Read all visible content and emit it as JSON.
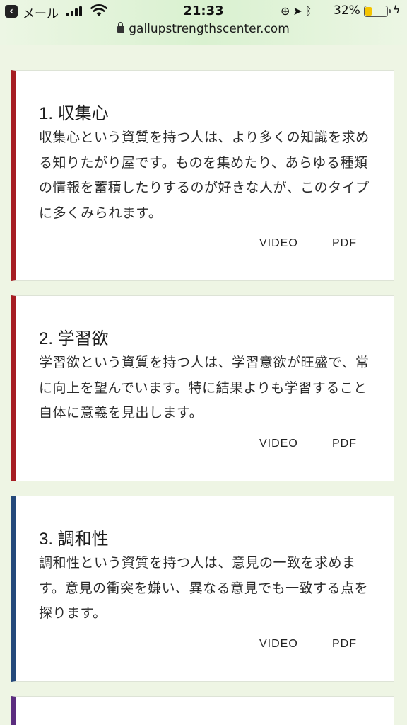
{
  "status": {
    "carrier": "メール",
    "time": "21:33",
    "battery_pct": "32%",
    "battery_level": 0.32,
    "battery_color": "#f5c400"
  },
  "browser": {
    "url": "gallupstrengthscenter.com"
  },
  "cards": [
    {
      "title": "1. 収集心",
      "description": "収集心という資質を持つ人は、より多くの知識を求める知りたがり屋です。ものを集めたり、あらゆる種類の情報を蓄積したりするのが好きな人が、このタイプに多くみられます。",
      "video_label": "VIDEO",
      "pdf_label": "PDF",
      "accent": "#a61d22"
    },
    {
      "title": "2. 学習欲",
      "description": "学習欲という資質を持つ人は、学習意欲が旺盛で、常に向上を望んでいます。特に結果よりも学習すること自体に意義を見出します。",
      "video_label": "VIDEO",
      "pdf_label": "PDF",
      "accent": "#a61d22"
    },
    {
      "title": "3. 調和性",
      "description": "調和性という資質を持つ人は、意見の一致を求めます。意見の衝突を嫌い、異なる意見でも一致する点を探ります。",
      "video_label": "VIDEO",
      "pdf_label": "PDF",
      "accent": "#24497a"
    }
  ],
  "next_card_accent": "#5b2d7f"
}
